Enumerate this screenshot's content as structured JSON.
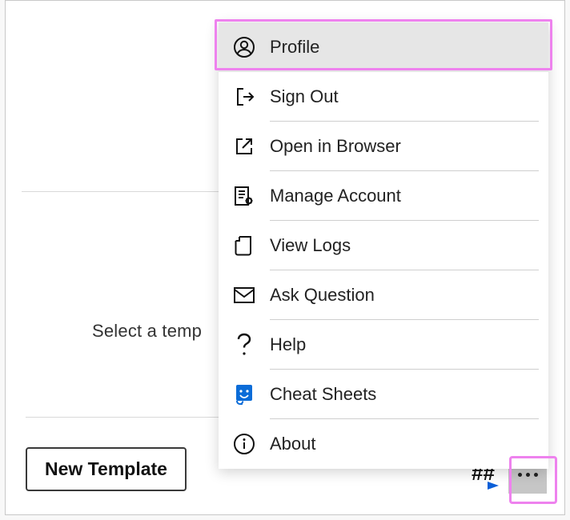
{
  "prompt": "Select a temp",
  "buttons": {
    "new_template": "New Template"
  },
  "menu": {
    "items": [
      {
        "label": "Profile"
      },
      {
        "label": "Sign Out"
      },
      {
        "label": "Open in Browser"
      },
      {
        "label": "Manage Account"
      },
      {
        "label": "View Logs"
      },
      {
        "label": "Ask Question"
      },
      {
        "label": "Help"
      },
      {
        "label": "Cheat Sheets"
      },
      {
        "label": "About"
      }
    ]
  }
}
